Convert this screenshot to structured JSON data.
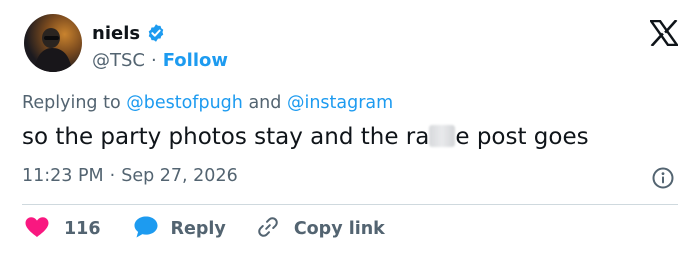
{
  "author": {
    "display_name": "niels",
    "handle": "@TSC",
    "separator": "·",
    "follow_label": "Follow",
    "verified": true
  },
  "reply_context": {
    "prefix": "Replying to",
    "mention_1": "@bestofpugh",
    "conjunction": "and",
    "mention_2": "@instagram"
  },
  "tweet": {
    "text_before_blur": "so the party photos stay and the ra",
    "text_after_blur": "e post goes"
  },
  "meta": {
    "time": "11:23 PM",
    "separator": "·",
    "date": "Sep 27, 2026"
  },
  "actions": {
    "like_count": "116",
    "reply_label": "Reply",
    "copy_label": "Copy link"
  },
  "icons": {
    "brand": "x-logo-icon",
    "verified": "verified-badge-icon",
    "info": "info-icon",
    "like": "heart-icon",
    "reply": "speech-bubble-icon",
    "copy": "link-icon"
  },
  "colors": {
    "accent": "#1d9bf0",
    "like": "#f91880",
    "muted_text": "#536471",
    "primary_text": "#0f1419",
    "divider": "#cfd9de"
  }
}
